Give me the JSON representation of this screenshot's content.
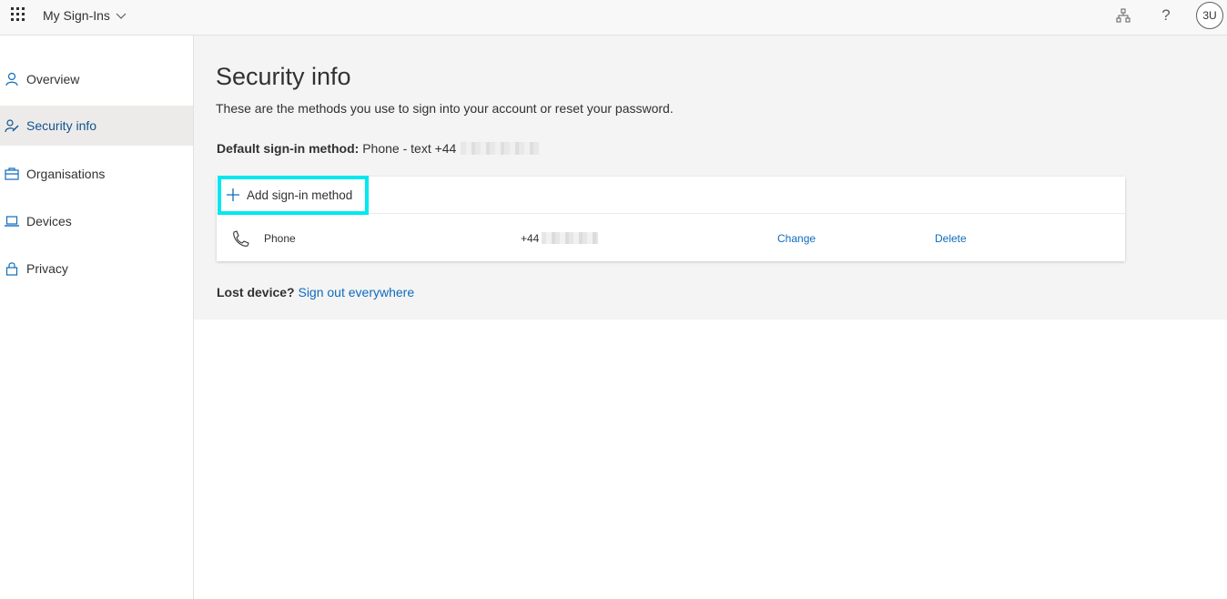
{
  "header": {
    "app_title": "My Sign-Ins",
    "help_glyph": "?",
    "avatar_initials": "3U",
    "icons": [
      "waffle-icon",
      "chevron-down-icon",
      "org-chart-icon",
      "help-icon"
    ]
  },
  "sidebar": {
    "items": [
      {
        "label": "Overview",
        "icon": "person-icon",
        "active": false
      },
      {
        "label": "Security info",
        "icon": "security-info-icon",
        "active": true
      },
      {
        "label": "Organisations",
        "icon": "briefcase-icon",
        "active": false
      },
      {
        "label": "Devices",
        "icon": "laptop-icon",
        "active": false
      },
      {
        "label": "Privacy",
        "icon": "lock-icon",
        "active": false
      }
    ]
  },
  "main": {
    "title": "Security info",
    "description": "These are the methods you use to sign into your account or reset your password.",
    "default_method_label": "Default sign-in method:",
    "default_method_value": "Phone - text +44",
    "add_method_label": "Add sign-in method",
    "methods": [
      {
        "name": "Phone",
        "value": "+44",
        "change_label": "Change",
        "delete_label": "Delete",
        "icon": "phone-icon"
      }
    ],
    "lost_device_label": "Lost device?",
    "sign_out_link": "Sign out everywhere"
  },
  "colors": {
    "accent": "#0f6cbd",
    "active_nav_text": "#0f5391",
    "highlight_border": "#00e8f0",
    "band_background": "#f4f4f4"
  }
}
